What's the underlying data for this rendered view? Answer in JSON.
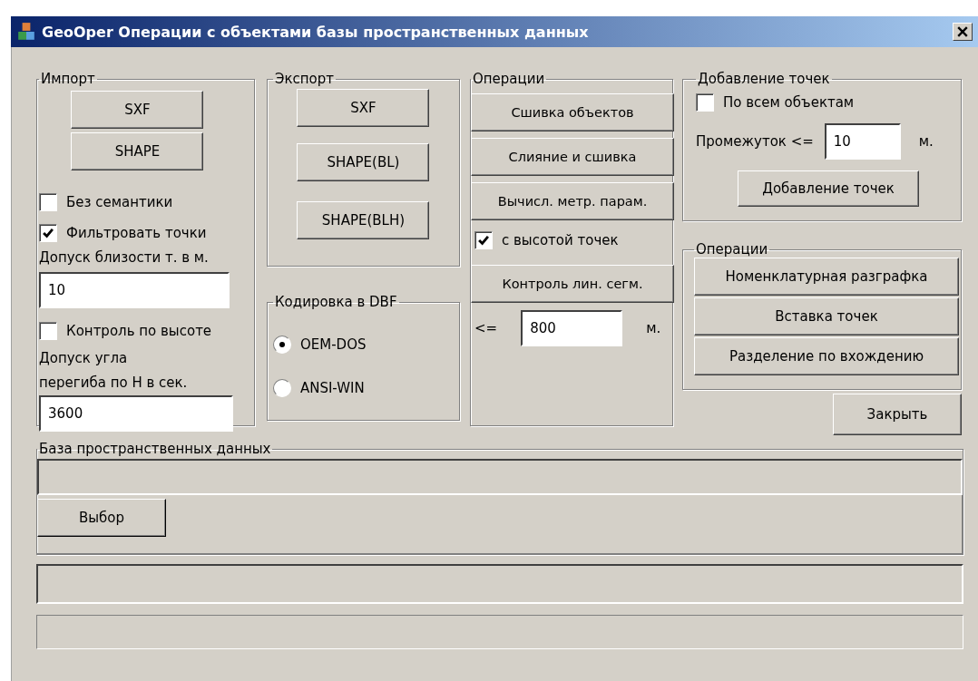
{
  "window": {
    "title": "GeoOper Операции с объектами базы пространственных данных"
  },
  "import": {
    "title": "Импорт",
    "buttons": [
      "SXF",
      "SHAPE"
    ],
    "options": [
      {
        "label": "Без семантики",
        "checked": false
      },
      {
        "label": "Фильтровать точки",
        "checked": true
      }
    ],
    "tolerance_label": "Допуск близости т. в м.",
    "tolerance_value": "10",
    "height_control": {
      "label": "Контроль по высоте",
      "checked": false
    },
    "angle_label": "Допуск угла\nперегиба по Н в сек.",
    "angle_value": "3600"
  },
  "export": {
    "title": "Экспорт",
    "buttons": [
      "SXF",
      "SHAPE(BL)",
      "SHAPE(BLH)"
    ]
  },
  "encoding": {
    "title": "Кодировка в DBF",
    "options": [
      {
        "label": "OEM-DOS",
        "selected": true
      },
      {
        "label": "ANSI-WIN",
        "selected": false
      }
    ]
  },
  "operations": {
    "title": "Операции",
    "buttons": [
      "Сшивка объектов",
      "Слияние и сшивка",
      "Вычисл. метр. парам."
    ],
    "with_heights": {
      "label": "с высотой точек",
      "checked": true
    },
    "segment_button": "Контроль лин. сегм.",
    "limit_prefix": "<=",
    "limit_value": "800",
    "limit_unit": "м."
  },
  "add_points": {
    "title": "Добавление точек",
    "all_objects": {
      "label": "По всем объектам",
      "checked": false
    },
    "interval_label": "Промежуток <=",
    "interval_value": "10",
    "interval_unit": "м.",
    "button": "Добавление точек"
  },
  "operations_2": {
    "title": "Операции",
    "buttons": [
      "Номенклатурная разграфка",
      "Вставка точек",
      "Разделение по вхождению"
    ]
  },
  "close_button": "Закрыть",
  "database": {
    "title": "База пространственных данных",
    "select_button": "Выбор"
  }
}
